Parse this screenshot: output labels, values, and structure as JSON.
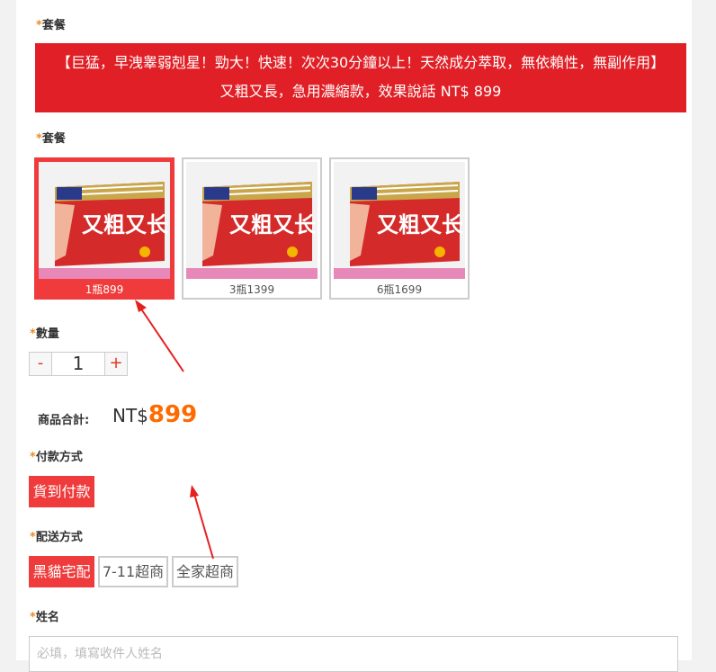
{
  "sections": {
    "package1_label": "套餐",
    "package2_label": "套餐",
    "quantity_label": "數量",
    "payment_label": "付款方式",
    "shipping_label": "配送方式",
    "name_label": "姓名",
    "required_mark": "*"
  },
  "banner": {
    "line1": "【巨猛，早洩睾弱剋星！勁大！快速！次次30分鐘以上！天然成分萃取，無依賴性，無副作用】",
    "line2": "又粗又長，急用濃縮款，效果說話 NT$ 899"
  },
  "product": {
    "box_text": "又粗又长",
    "options": [
      {
        "caption": "1瓶899",
        "selected": true
      },
      {
        "caption": "3瓶1399",
        "selected": false
      },
      {
        "caption": "6瓶1699",
        "selected": false
      }
    ]
  },
  "quantity": {
    "minus": "-",
    "value": "1",
    "plus": "+"
  },
  "total": {
    "label": "商品合計:",
    "currency": "NT$",
    "amount": "899"
  },
  "payment": {
    "options": [
      {
        "label": "貨到付款",
        "selected": true
      }
    ]
  },
  "shipping": {
    "options": [
      {
        "label": "黑貓宅配",
        "selected": true
      },
      {
        "label": "7-11超商",
        "selected": false
      },
      {
        "label": "全家超商",
        "selected": false
      }
    ]
  },
  "name_field": {
    "placeholder": "必填，填寫收件人姓名",
    "value": ""
  },
  "colors": {
    "accent": "#ef3b3b",
    "banner": "#e02026",
    "price": "#ff6a00",
    "required": "#f08a24"
  }
}
